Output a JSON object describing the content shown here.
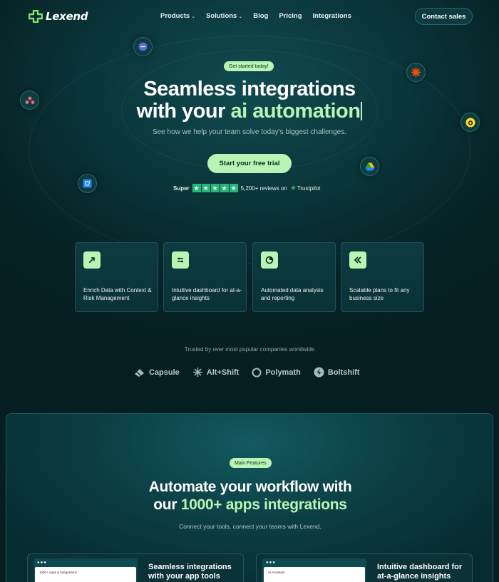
{
  "brand": {
    "name": "Lexend"
  },
  "nav": {
    "items": [
      {
        "label": "Products",
        "has_dropdown": true
      },
      {
        "label": "Solutions",
        "has_dropdown": true
      },
      {
        "label": "Blog",
        "has_dropdown": false
      },
      {
        "label": "Pricing",
        "has_dropdown": false
      },
      {
        "label": "Integrations",
        "has_dropdown": false
      }
    ],
    "contact_label": "Contact sales"
  },
  "hero": {
    "badge": "Get started today!",
    "title_line1": "Seamless integrations",
    "title_line2_prefix": "with your ",
    "title_line2_accent": "ai automation",
    "subtitle": "See how we help your team solve today's biggest challenges.",
    "cta_label": "Start your free trial",
    "rating": {
      "label": "Super",
      "stars": 5,
      "reviews": "5,200+ reviews on",
      "platform": "Trustpilot"
    }
  },
  "floating_icons": [
    "linear-icon",
    "asana-icon",
    "bitbucket-icon",
    "zapier-icon",
    "mailchimp-icon",
    "google-drive-icon"
  ],
  "features": [
    {
      "icon": "enrich-icon",
      "text": "Enrich Data with Context & Risk Management"
    },
    {
      "icon": "dashboard-icon",
      "text": "Intuitive dashboard for at-a-glance insights"
    },
    {
      "icon": "analysis-icon",
      "text": "Automated data analysis and reporting"
    },
    {
      "icon": "scalable-icon",
      "text": "Scalable plans to fit any business size"
    }
  ],
  "trusted": {
    "heading": "Trusted by over most popular companies worldwide",
    "brands": [
      "Capsule",
      "Alt+Shift",
      "Polymath",
      "Boltshift"
    ]
  },
  "section": {
    "badge": "Main Features",
    "title_line1": "Automate your workflow with",
    "title_line2_prefix": "our ",
    "title_line2_accent": "1000+ apps integrations",
    "subtitle": "Connect your tools, connect your teams with Lexend.",
    "previews": [
      {
        "window_label": "1000+ Apps & Integrations",
        "title": "Seamless integrations with your app tools"
      },
      {
        "window_label": "AI Assistant",
        "title": "Intuitive dashboard for at-a-glance insights"
      }
    ]
  },
  "colors": {
    "accent": "#b8f5b5",
    "background": "#062326",
    "trustpilot": "#25b67a"
  }
}
